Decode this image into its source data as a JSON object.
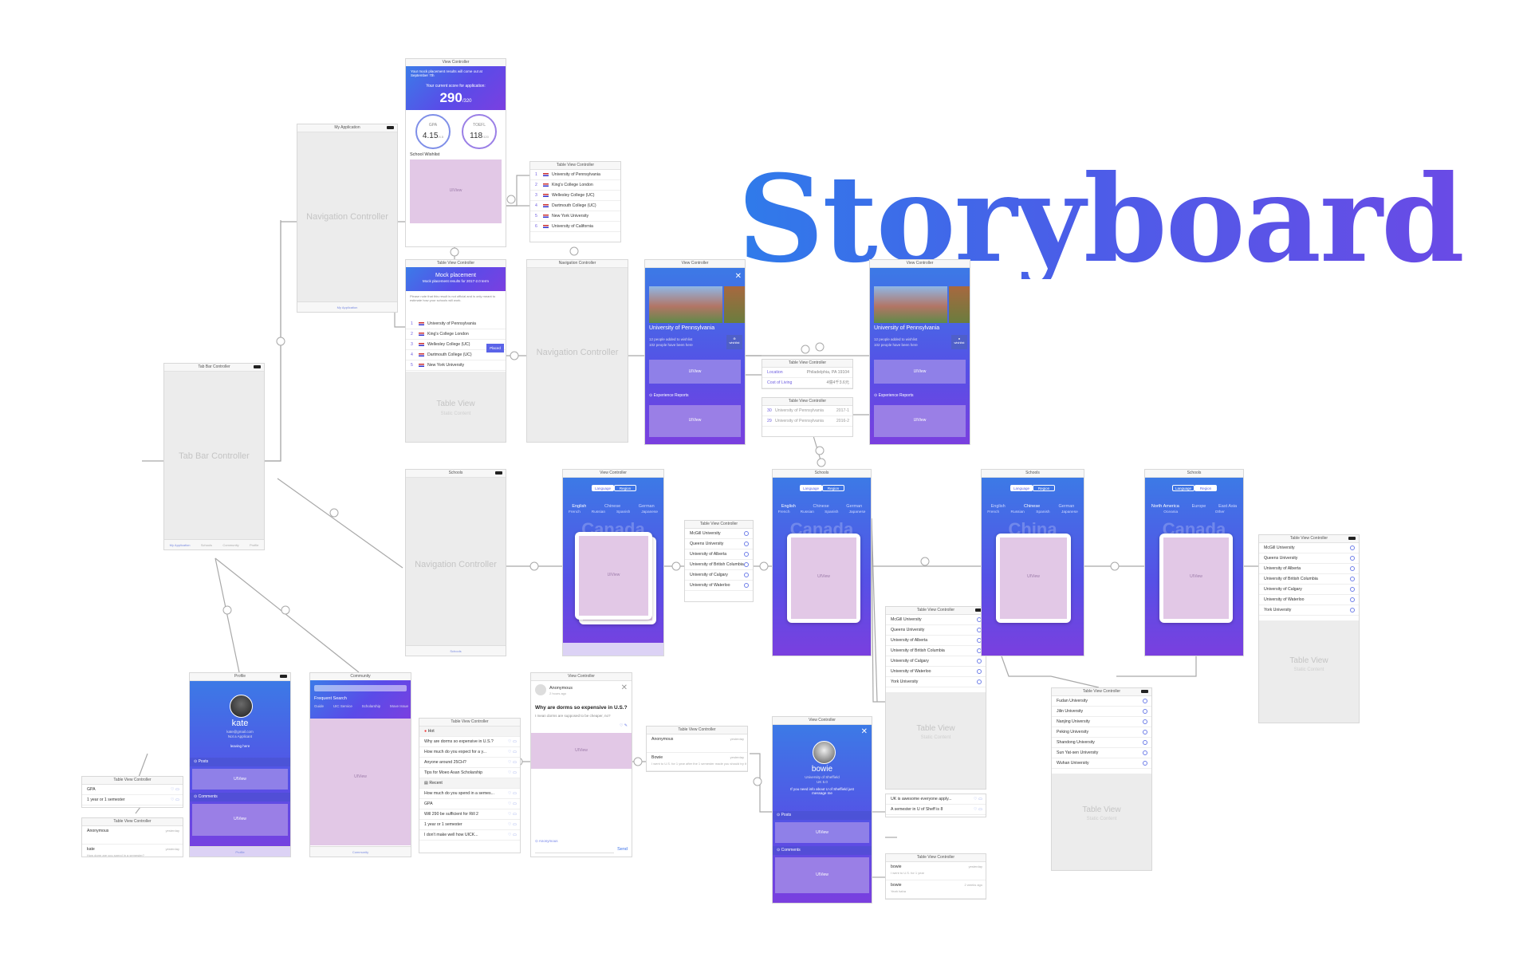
{
  "title": "Storyboard",
  "scene_titles": {
    "tab_bar": "Tab Bar Controller",
    "my_application": "My Application",
    "view_controller": "View Controller",
    "table_view_controller": "Table View Controller",
    "navigation_controller": "Navigation Controller",
    "schools": "Schools",
    "profile": "Profile",
    "community": "Community"
  },
  "placeholders": {
    "tab_bar_controller": "Tab Bar Controller",
    "navigation_controller": "Navigation Controller",
    "table_view": "Table View",
    "static_content": "Static Content",
    "uiview": "UIView"
  },
  "tab_items": [
    "My Application",
    "Schools",
    "Community",
    "Profile"
  ],
  "score": {
    "notice": "Your mock placement results will come out at September 7th",
    "caption": "Your current score for application:",
    "value": "290",
    "max": "/320",
    "gpa_label": "GPA",
    "gpa_value": "4.15",
    "gpa_max": "/4.5",
    "toefl_label": "TOEFL",
    "toefl_value": "118",
    "toefl_max": "/120",
    "wishlist": "School Wishlist"
  },
  "wishlist_rows": [
    {
      "n": "1",
      "name": "University of Pennsylvania"
    },
    {
      "n": "2",
      "name": "King's College London"
    },
    {
      "n": "3",
      "name": "Wellesley College (UC)"
    },
    {
      "n": "4",
      "name": "Dartmouth College (UC)"
    },
    {
      "n": "5",
      "name": "New York University"
    },
    {
      "n": "6",
      "name": "University of California"
    }
  ],
  "mock": {
    "title": "Mock placement",
    "subtitle": "Mock placement results for 2017-2.0 term",
    "info": "Please note that this result is not official and is only meant to estimate how your schools will work.",
    "placed": "Placed",
    "rows": [
      {
        "n": "1",
        "name": "University of Pennsylvania"
      },
      {
        "n": "2",
        "name": "King's College London"
      },
      {
        "n": "3",
        "name": "Wellesley College (UC)"
      },
      {
        "n": "4",
        "name": "Dartmouth College (UC)"
      },
      {
        "n": "5",
        "name": "New York University"
      }
    ]
  },
  "upenn": {
    "name": "University of Pennsylvania",
    "info1": "12 people added to wishlist",
    "info2": "102 people have been here",
    "wishlist": "wishlist",
    "experience": "Experience Reports"
  },
  "upenn_details": {
    "location_label": "Location",
    "location_value": "Philadelphia, PA 19104",
    "cost_label": "Cost of Living",
    "cost_value": "4億4千3.6元"
  },
  "experience_rows": [
    {
      "n": "30",
      "name": "University of Pennsylvania",
      "year": "2017-1"
    },
    {
      "n": "29",
      "name": "University of Pennsylvania",
      "year": "2016-2"
    }
  ],
  "segments": {
    "language": "Language",
    "region": "Region"
  },
  "languages": {
    "row1": [
      "English",
      "Chinese",
      "German"
    ],
    "row2": [
      "French",
      "Russian",
      "Spanish",
      "Japanese"
    ]
  },
  "regions": {
    "row1": [
      "North America",
      "Europe",
      "East Asia"
    ],
    "row2": [
      "Oceania",
      "Other"
    ]
  },
  "countries": {
    "canada": "Canada",
    "china": "China"
  },
  "canada_schools": [
    "McGill University",
    "Queens University",
    "University of Alberta",
    "University of British Columbia",
    "University of Calgary",
    "University of Waterloo",
    "York University"
  ],
  "china_schools": [
    "Fudan University",
    "Jilin University",
    "Nanjing University",
    "Peking University",
    "Shandong University",
    "Sun Yat-sen University",
    "Wuhan University"
  ],
  "profile": {
    "name": "kate",
    "email": "kate@gmail.com",
    "status": "Not a Applicant",
    "location": "leaving here",
    "posts": "Posts",
    "comments": "Comments"
  },
  "profile_posts_rows": [
    {
      "text": "GPA"
    },
    {
      "text": "1 year or 1 semester"
    }
  ],
  "profile_comment_rows": [
    {
      "name": "Anonymous",
      "time": "yesterday",
      "text": ""
    },
    {
      "name": "kate",
      "time": "yesterday",
      "text": "How dorm are you spend in a semester?"
    }
  ],
  "community": {
    "search_title": "Frequent Search",
    "tags": [
      "Guide",
      "UIC Service",
      "Scholarship",
      "Move Issue"
    ]
  },
  "community_table": {
    "hot": "Hot",
    "recent": "Recent",
    "hot_rows": [
      "Why are dorms so expensive in U.S.?",
      "How much do you expect for a y...",
      "Anyone around 25CH?",
      "Tips for Moeo Asan Scholarship"
    ],
    "recent_rows": [
      "How much do you spend in a semes...",
      "GPA",
      "Will 290 be sufficient for Rill 2",
      "1 year or 1 semester",
      "I don't make well how UICK..."
    ]
  },
  "post": {
    "author": "Anonymous",
    "time": "2 hours ago",
    "question": "Why are dorms so expensive in U.S.?",
    "body": "I mean dorms are supposed to be cheaper, no?",
    "commenter": "Anonymous",
    "send": "Send"
  },
  "post_comments": [
    {
      "name": "Anonymous",
      "time": "yesterday",
      "text": ""
    },
    {
      "name": "Bowie",
      "time": "yesterday",
      "text": "I went to U.S. for 1 year after the 1 semester made you should try it"
    }
  ],
  "bowie": {
    "name": "bowie",
    "school": "University of Sheffield",
    "year": "UK 5.0",
    "bio": "If you need info about U of Sheffield just message me",
    "posts": "Posts",
    "comments": "Comments"
  },
  "bowie_post_rows": [
    {
      "text": "UK is awesome everyone apply..."
    },
    {
      "text": "A semester in U of Sheff is 8"
    }
  ],
  "bowie_comment_rows": [
    {
      "name": "bowie",
      "time": "yesterday",
      "text": "I went to U.S. for 1 year"
    },
    {
      "name": "bowie",
      "time": "2 weeks ago",
      "text": "Yeah haha"
    }
  ]
}
